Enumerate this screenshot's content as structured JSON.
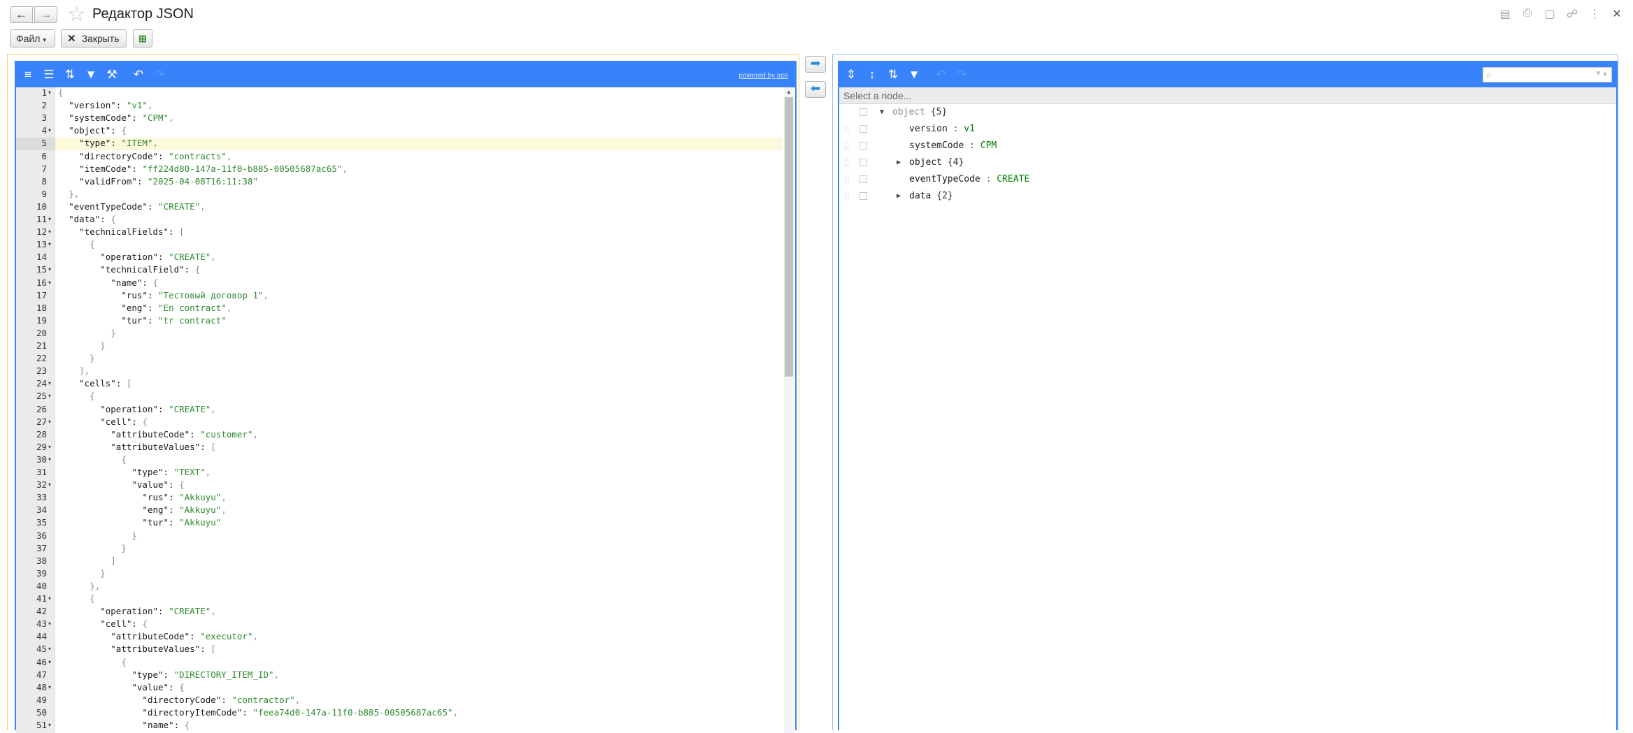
{
  "window": {
    "title": "Редактор JSON",
    "back_icon": "arrow-left-icon",
    "forward_icon": "arrow-right-icon",
    "favorite_icon": "star-icon"
  },
  "toolbar": {
    "file_label": "Файл",
    "close_label": "Закрыть"
  },
  "editor": {
    "powered_by": "powered by ace",
    "line_numbers": [
      "1",
      "2",
      "3",
      "4",
      "5",
      "6",
      "7",
      "8",
      "9",
      "10",
      "11",
      "12",
      "13",
      "14",
      "15",
      "16",
      "17",
      "18",
      "19",
      "20",
      "21",
      "22",
      "23",
      "24",
      "25",
      "26",
      "27",
      "28",
      "29",
      "30",
      "31",
      "32",
      "33",
      "34",
      "35",
      "36",
      "37",
      "38",
      "39",
      "40",
      "41",
      "42",
      "43",
      "44",
      "45",
      "46",
      "47",
      "48",
      "49",
      "50",
      "51"
    ],
    "lines": [
      "{",
      "  \"version\": \"v1\",",
      "  \"systemCode\": \"CPM\",",
      "  \"object\": {",
      "    \"type\": \"ITEM\",",
      "    \"directoryCode\": \"contracts\",",
      "    \"itemCode\": \"ff224d80-147a-11f0-b885-00505687ac65\",",
      "    \"validFrom\": \"2025-04-08T16:11:38\"",
      "  },",
      "  \"eventTypeCode\": \"CREATE\",",
      "  \"data\": {",
      "    \"technicalFields\": [",
      "      {",
      "        \"operation\": \"CREATE\",",
      "        \"technicalField\": {",
      "          \"name\": {",
      "            \"rus\": \"Тестовый договор 1\",",
      "            \"eng\": \"En contract\",",
      "            \"tur\": \"tr contract\"",
      "          }",
      "        }",
      "      }",
      "    ],",
      "    \"cells\": [",
      "      {",
      "        \"operation\": \"CREATE\",",
      "        \"cell\": {",
      "          \"attributeCode\": \"customer\",",
      "          \"attributeValues\": [",
      "            {",
      "              \"type\": \"TEXT\",",
      "              \"value\": {",
      "                \"rus\": \"Akkuyu\",",
      "                \"eng\": \"Akkuyu\",",
      "                \"tur\": \"Akkuyu\"",
      "              }",
      "            }",
      "          ]",
      "        }",
      "      },",
      "      {",
      "        \"operation\": \"CREATE\",",
      "        \"cell\": {",
      "          \"attributeCode\": \"executor\",",
      "          \"attributeValues\": [",
      "            {",
      "              \"type\": \"DIRECTORY_ITEM_ID\",",
      "              \"value\": {",
      "                \"directoryCode\": \"contractor\",",
      "                \"directoryItemCode\": \"feea74d0-147a-11f0-b885-00505687ac65\",",
      "                \"name\": {"
    ],
    "fold_lines": [
      1,
      4,
      11,
      12,
      13,
      15,
      16,
      24,
      25,
      27,
      29,
      30,
      32,
      41,
      43,
      45,
      46,
      48,
      51
    ],
    "active_line": 5
  },
  "tree": {
    "nav_placeholder": "Select a node...",
    "nodes": [
      {
        "name": "object",
        "count": "{5}",
        "value": "",
        "expanded": true,
        "root": true
      },
      {
        "name": "version",
        "value": "v1"
      },
      {
        "name": "systemCode",
        "value": "CPM"
      },
      {
        "name": "object",
        "count": "{4}",
        "value": "",
        "collapsed": true
      },
      {
        "name": "eventTypeCode",
        "value": "CREATE"
      },
      {
        "name": "data",
        "count": "{2}",
        "value": "",
        "collapsed": true
      }
    ]
  },
  "colors": {
    "accent": "#3883fa",
    "string": "#2e8b2e",
    "active_line": "#fcf9dd"
  }
}
